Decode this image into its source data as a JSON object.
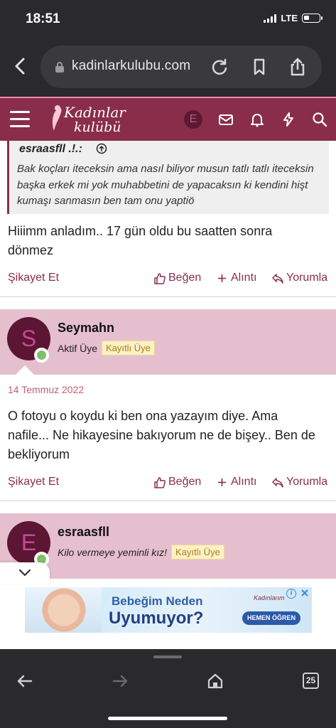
{
  "status": {
    "time": "18:51",
    "network": "LTE"
  },
  "browser": {
    "url": "kadinlarkulubu.com",
    "tabs_count": "25"
  },
  "site": {
    "logo_line1": "Kadınlar",
    "logo_line2": "kulübü",
    "user_initial": "E"
  },
  "quote": {
    "author": "esraasfll .!.:",
    "body": "Bak koçları iteceksin ama nasıl biliyor musun tatlı tatlı iteceksin başka erkek mi yok muhabbetini de yapacaksın ki kendini hişt kumaşı sanmasın ben tam onu yaptiö"
  },
  "posts": [
    {
      "text": "Hiiimm anladım.. 17 gün oldu bu saatten sonra dönmez"
    },
    {
      "author": "Seymahn",
      "initial": "S",
      "user_title": "Aktif Üye",
      "badge": "Kayıtlı Üye",
      "date": "14 Temmuz 2022",
      "text": "O fotoyu o koydu ki ben ona yazayım diye. Ama nafile... Ne hikayesine bakıyorum ne de bişey.. Ben de bekliyorum"
    },
    {
      "author": "esraasfll",
      "initial": "E",
      "user_title": "Kilo vermeye yeminli kız!",
      "badge": "Kayıtlı Üye"
    }
  ],
  "actions": {
    "report": "Şikayet Et",
    "like": "Beğen",
    "quote": "Alıntı",
    "reply": "Yorumla"
  },
  "ad": {
    "line1": "Bebeğim Neden",
    "line2": "Uyumuyor?",
    "brand": "Kadınlarım",
    "cta": "HEMEN ÖĞREN"
  },
  "colors": {
    "brand": "#8a2d4b",
    "userbar": "#e6bfcf",
    "badge": "#fbf0c8"
  }
}
